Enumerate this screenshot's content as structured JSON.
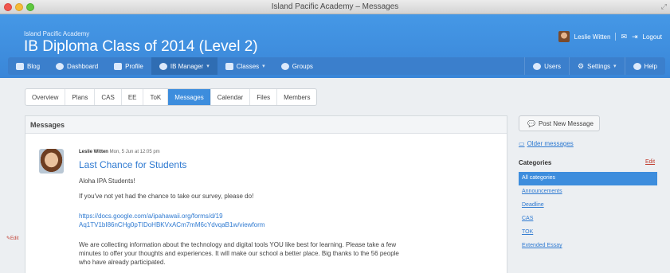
{
  "window": {
    "title": "Island Pacific Academy – Messages"
  },
  "header": {
    "school": "Island Pacific Academy",
    "class_title": "IB Diploma Class of 2014 (Level 2)",
    "user_name": "Leslie Witten",
    "logout": "Logout"
  },
  "nav": {
    "left": [
      {
        "label": "Blog",
        "icon": "blog-icon"
      },
      {
        "label": "Dashboard",
        "icon": "dashboard-icon"
      },
      {
        "label": "Profile",
        "icon": "profile-icon"
      },
      {
        "label": "IB Manager",
        "icon": "ib-manager-icon"
      },
      {
        "label": "Classes",
        "icon": "classes-icon"
      },
      {
        "label": "Groups",
        "icon": "groups-icon"
      }
    ],
    "right": [
      {
        "label": "Users",
        "icon": "users-icon"
      },
      {
        "label": "Settings",
        "icon": "gear-icon"
      },
      {
        "label": "Help",
        "icon": "help-icon"
      }
    ]
  },
  "tabs": [
    "Overview",
    "Plans",
    "CAS",
    "EE",
    "ToK",
    "Messages",
    "Calendar",
    "Files",
    "Members"
  ],
  "active_tab": "Messages",
  "panel": {
    "title": "Messages",
    "edit": "Edit"
  },
  "message": {
    "author": "Leslie Witten",
    "date": "Mon, 5 Jun at 12:05 pm",
    "title": "Last Chance for Students",
    "greeting": "Aloha IPA Students!",
    "p1": "If you've not yet had the chance to take our survey, please do!",
    "link_line1": "https://docs.google.com/a/ipahawaii.org/forms/d/19",
    "link_line2": "Aq1TV1bI86nCHg0pTIDoHBKVxACm7mM6cYdvqaB1w/viewform",
    "p2_line1": "We are collecting information about the technology and digital tools YOU like best for learning. Please take a few",
    "p2_line2": "minutes to offer your thoughts and experiences. It will make our school a better place. Big thanks to the 56 people",
    "p2_line3": "who have already participated."
  },
  "sidebar": {
    "post_button": "Post New Message",
    "older": "Older messages",
    "categories_label": "Categories",
    "categories_edit": "Edit",
    "categories": [
      "All categories",
      "Announcements",
      "Deadline",
      "CAS",
      "TOK",
      "Extended Essay"
    ],
    "active_category": "All categories"
  }
}
